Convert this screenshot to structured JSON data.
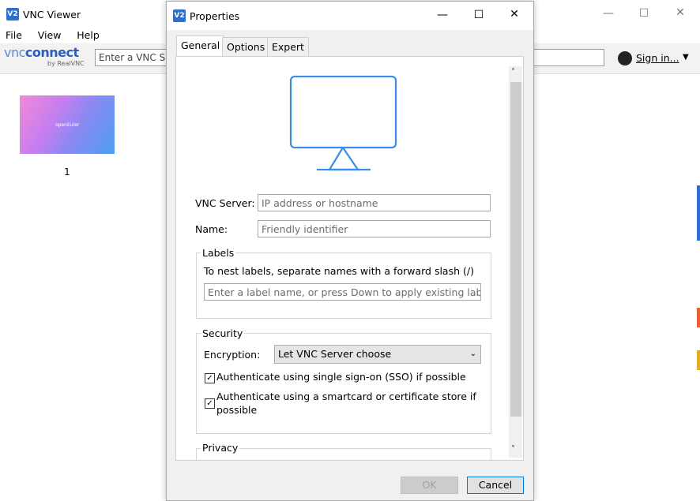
{
  "main_window": {
    "title": "VNC Viewer",
    "icon": "vnc-viewer-icon",
    "menu": [
      "File",
      "View",
      "Help"
    ],
    "logo": {
      "vnc": "vnc",
      "connect": "connect",
      "sub": "by RealVNC"
    },
    "search_placeholder": "Enter a VNC Se",
    "sign_in": "Sign in...",
    "thumbnail": {
      "label": "1",
      "caption": "openEuler"
    }
  },
  "dialog": {
    "title": "Properties",
    "icon": "vnc-viewer-icon",
    "tabs": [
      "General",
      "Options",
      "Expert"
    ],
    "active_tab": "General",
    "monitor_icon": "monitor-icon",
    "vnc_server": {
      "label": "VNC Server:",
      "placeholder": "IP address or hostname"
    },
    "name": {
      "label": "Name:",
      "placeholder": "Friendly identifier"
    },
    "labels_group": {
      "title": "Labels",
      "hint": "To nest labels, separate names with a forward slash (/)",
      "placeholder": "Enter a label name, or press Down to apply existing labels"
    },
    "security_group": {
      "title": "Security",
      "encryption_label": "Encryption:",
      "encryption_value": "Let VNC Server choose",
      "checks": [
        {
          "label": "Authenticate using single sign-on (SSO) if possible",
          "checked": true
        },
        {
          "label_line1": "Authenticate using a smartcard or certificate store if",
          "label_line2": "possible",
          "checked": true
        }
      ]
    },
    "privacy_group": {
      "title": "Privacy"
    },
    "buttons": {
      "ok": "OK",
      "cancel": "Cancel"
    },
    "colors": {
      "accent": "#0078d7",
      "monitor": "#3a8ee6"
    }
  }
}
